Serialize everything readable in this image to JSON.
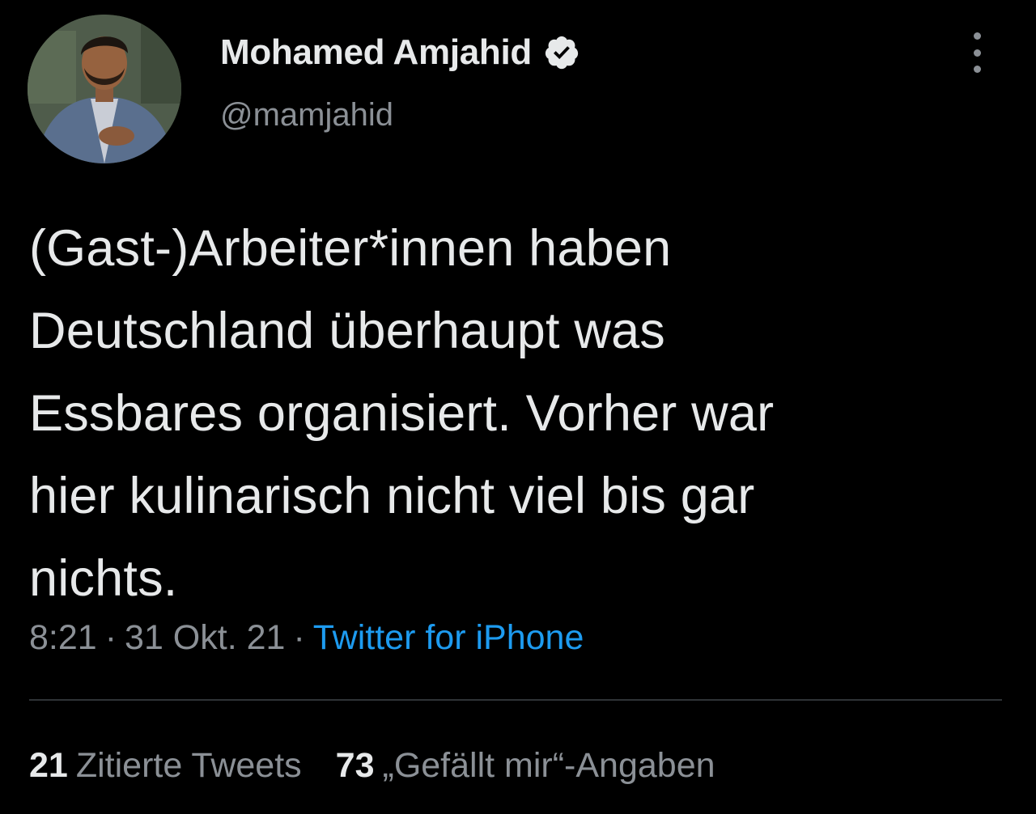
{
  "author": {
    "display_name": "Mohamed Amjahid",
    "handle": "@mamjahid",
    "verified_icon": "verified-badge-icon"
  },
  "tweet": {
    "text": "(Gast-)Arbeiter*innen haben\nDeutschland überhaupt was\nEssbares organisiert. Vorher war\nhier kulinarisch nicht viel bis gar\nnichts.",
    "time": "8:21",
    "separator": "·",
    "date": "31 Okt. 21",
    "source": "Twitter for iPhone"
  },
  "stats": {
    "quotes_count": "21",
    "quotes_label": "Zitierte Tweets",
    "likes_count": "73",
    "likes_label": "„Gefällt mir“-Angaben"
  },
  "colors": {
    "background": "#000000",
    "text": "#e7e9ea",
    "secondary": "#8b9096",
    "accent": "#1d9bf0",
    "divider": "#2f3336"
  }
}
